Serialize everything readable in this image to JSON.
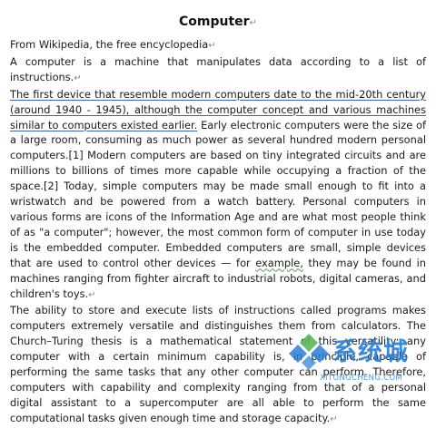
{
  "document": {
    "title": "Computer",
    "paragraph_mark": "↵",
    "source_line": "From Wikipedia, the free encyclopedia",
    "intro": "A computer is a machine that manipulates data according to a list of instructions.",
    "underlined_sentence": "The first device that resemble modern computers date to the mid-20th century (around 1940 - 1945), although the computer concept and various machines similar to computers existed earlier.",
    "p2_a": " Early electronic computers were the size of a large room, consuming as much power as several hundred modern personal computers.",
    "p2_cite1": "[1]",
    "p2_b": " Modern computers are based on tiny integrated circuits and are millions to billions of times more capable while occupying a fraction of the space.",
    "p2_cite2": "[2]",
    "p2_c": " Today, simple computers may be made small enough to fit into a wristwatch and be powered from a watch battery. Personal computers in various forms are icons of the Information Age and are what most people think of as \"a computer\"; however, the most common form of computer in use today is the embedded computer. Embedded computers are small, simple devices that are used to control other devices — for ",
    "p2_example": "example,",
    "p2_d": " they may be found in machines ranging from fighter aircraft to industrial robots, digital cameras, and children's toys.",
    "p3": "The ability to store and execute lists of instructions called programs makes computers extremely versatile and distinguishes them from calculators. The Church–Turing thesis is a mathematical statement of this versatility: any computer with a certain minimum capability is, in principle, capable of performing the same tasks that any other computer can perform. Therefore, computers with capability and complexity ranging from that of a personal digital assistant to a supercomputer are all able to perform the same computational tasks given enough time and storage capacity."
  },
  "watermark": {
    "brand": "系统城",
    "url": "XITONGCHENG.COM",
    "colors": {
      "blue": "#2a7fd8",
      "green": "#5cb85c"
    }
  },
  "colors": {
    "underline_blue": "#3b62c8",
    "underline_green": "#4f9a4f",
    "text": "#1a1a1a"
  }
}
